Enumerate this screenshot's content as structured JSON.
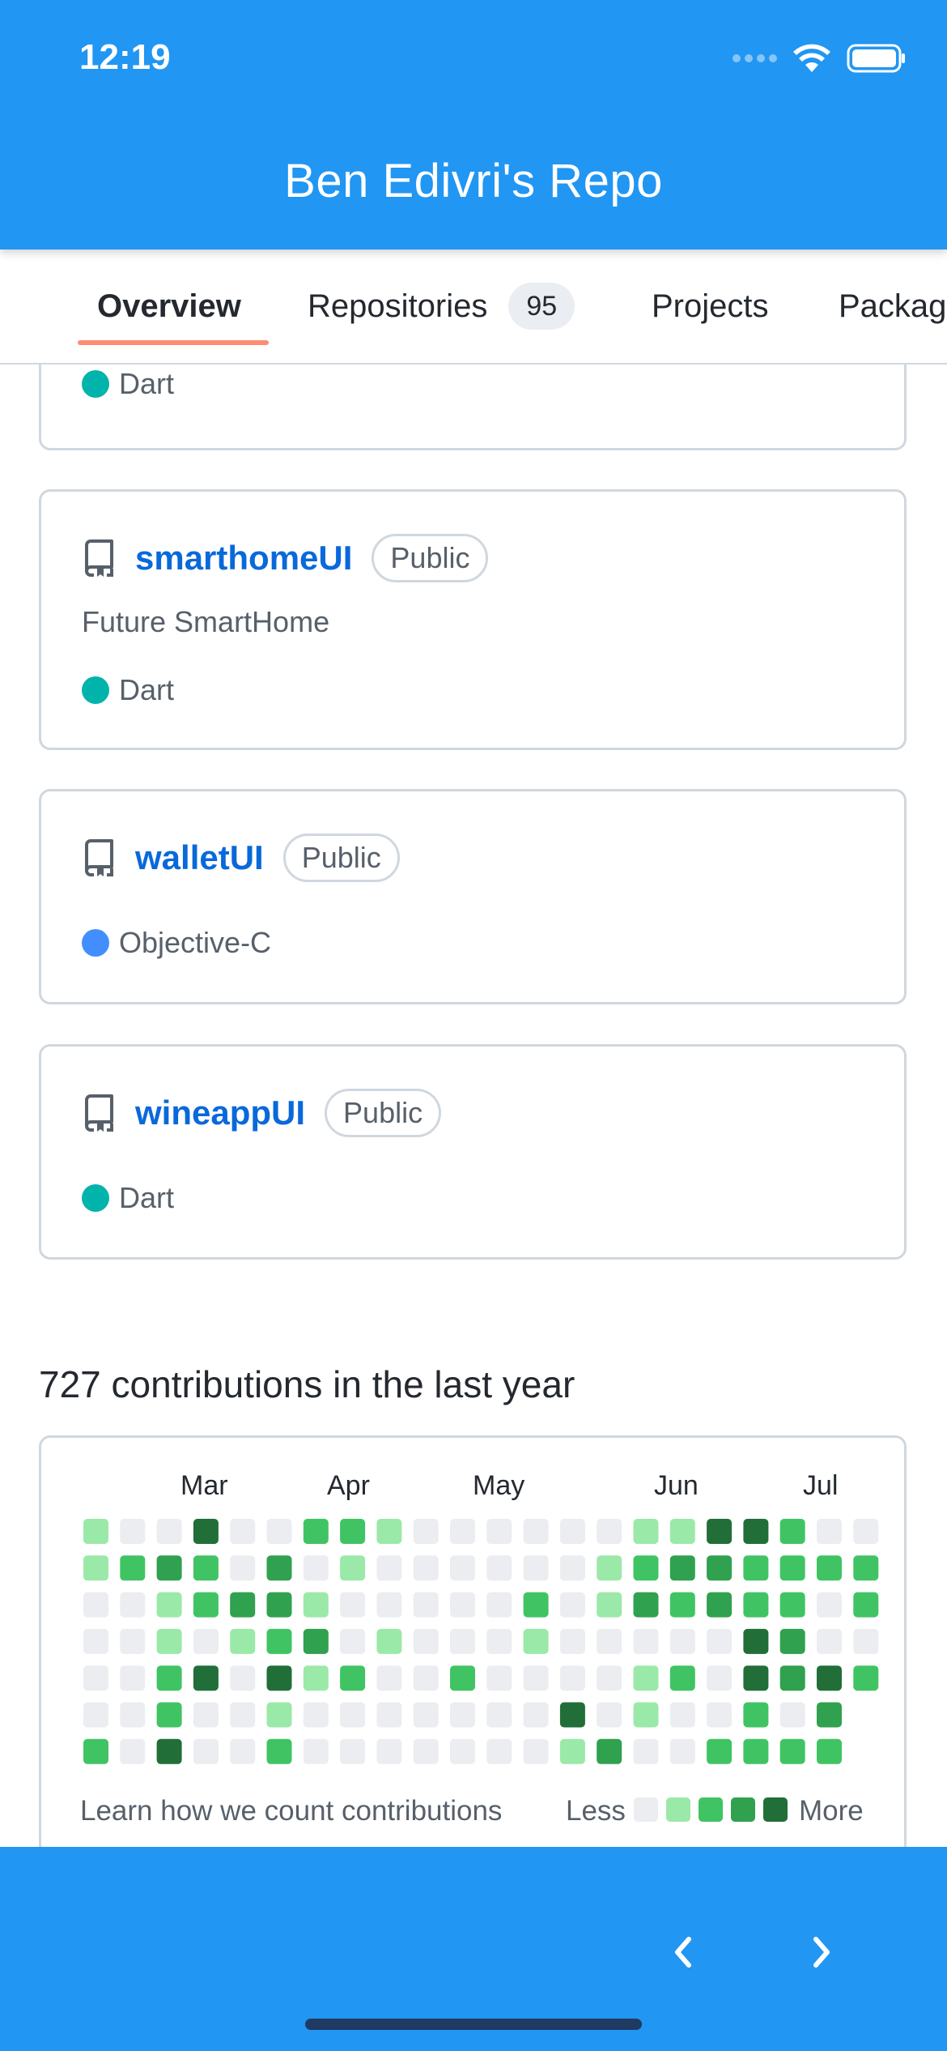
{
  "status_bar": {
    "time": "12:19"
  },
  "app_bar": {
    "title": "Ben Edivri's Repo"
  },
  "tabs": [
    {
      "label": "Overview",
      "active": true
    },
    {
      "label": "Repositories",
      "count": "95"
    },
    {
      "label": "Projects"
    },
    {
      "label": "Packages"
    }
  ],
  "repos": [
    {
      "name": "",
      "language": "Dart",
      "language_color": "#00b4ab"
    },
    {
      "name": "smarthomeUI",
      "badge": "Public",
      "description": "Future SmartHome",
      "language": "Dart",
      "language_color": "#00b4ab"
    },
    {
      "name": "walletUI",
      "badge": "Public",
      "language": "Objective-C",
      "language_color": "#438eff"
    },
    {
      "name": "wineappUI",
      "badge": "Public",
      "language": "Dart",
      "language_color": "#00b4ab"
    }
  ],
  "contributions": {
    "title": "727 contributions in the last year",
    "months": [
      "Mar",
      "Apr",
      "May",
      "Jun",
      "Jul"
    ],
    "learn_link": "Learn how we count contributions",
    "legend_less": "Less",
    "legend_more": "More",
    "colors": [
      "#ebedf0",
      "#9be9a8",
      "#40c463",
      "#30a14e",
      "#216e39"
    ],
    "grid": [
      [
        1,
        0,
        0,
        4,
        0,
        0,
        2,
        2,
        1,
        0,
        0,
        0,
        0,
        0,
        0,
        1,
        1,
        4,
        4,
        2,
        0,
        0
      ],
      [
        1,
        2,
        3,
        2,
        0,
        3,
        0,
        1,
        0,
        0,
        0,
        0,
        0,
        0,
        1,
        2,
        3,
        3,
        2,
        2,
        2,
        2
      ],
      [
        0,
        0,
        1,
        2,
        3,
        3,
        1,
        0,
        0,
        0,
        0,
        0,
        2,
        0,
        1,
        3,
        2,
        3,
        2,
        2,
        0,
        2
      ],
      [
        0,
        0,
        1,
        0,
        1,
        2,
        3,
        0,
        1,
        0,
        0,
        0,
        1,
        0,
        0,
        0,
        0,
        0,
        4,
        3,
        0,
        0
      ],
      [
        0,
        0,
        2,
        4,
        0,
        4,
        1,
        2,
        0,
        0,
        2,
        0,
        0,
        0,
        0,
        1,
        2,
        0,
        4,
        3,
        4,
        2
      ],
      [
        0,
        0,
        2,
        0,
        0,
        1,
        0,
        0,
        0,
        0,
        0,
        0,
        0,
        4,
        0,
        1,
        0,
        0,
        2,
        0,
        3,
        null
      ],
      [
        2,
        0,
        4,
        0,
        0,
        2,
        0,
        0,
        0,
        0,
        0,
        0,
        0,
        1,
        3,
        0,
        0,
        2,
        2,
        2,
        2,
        null
      ]
    ]
  }
}
